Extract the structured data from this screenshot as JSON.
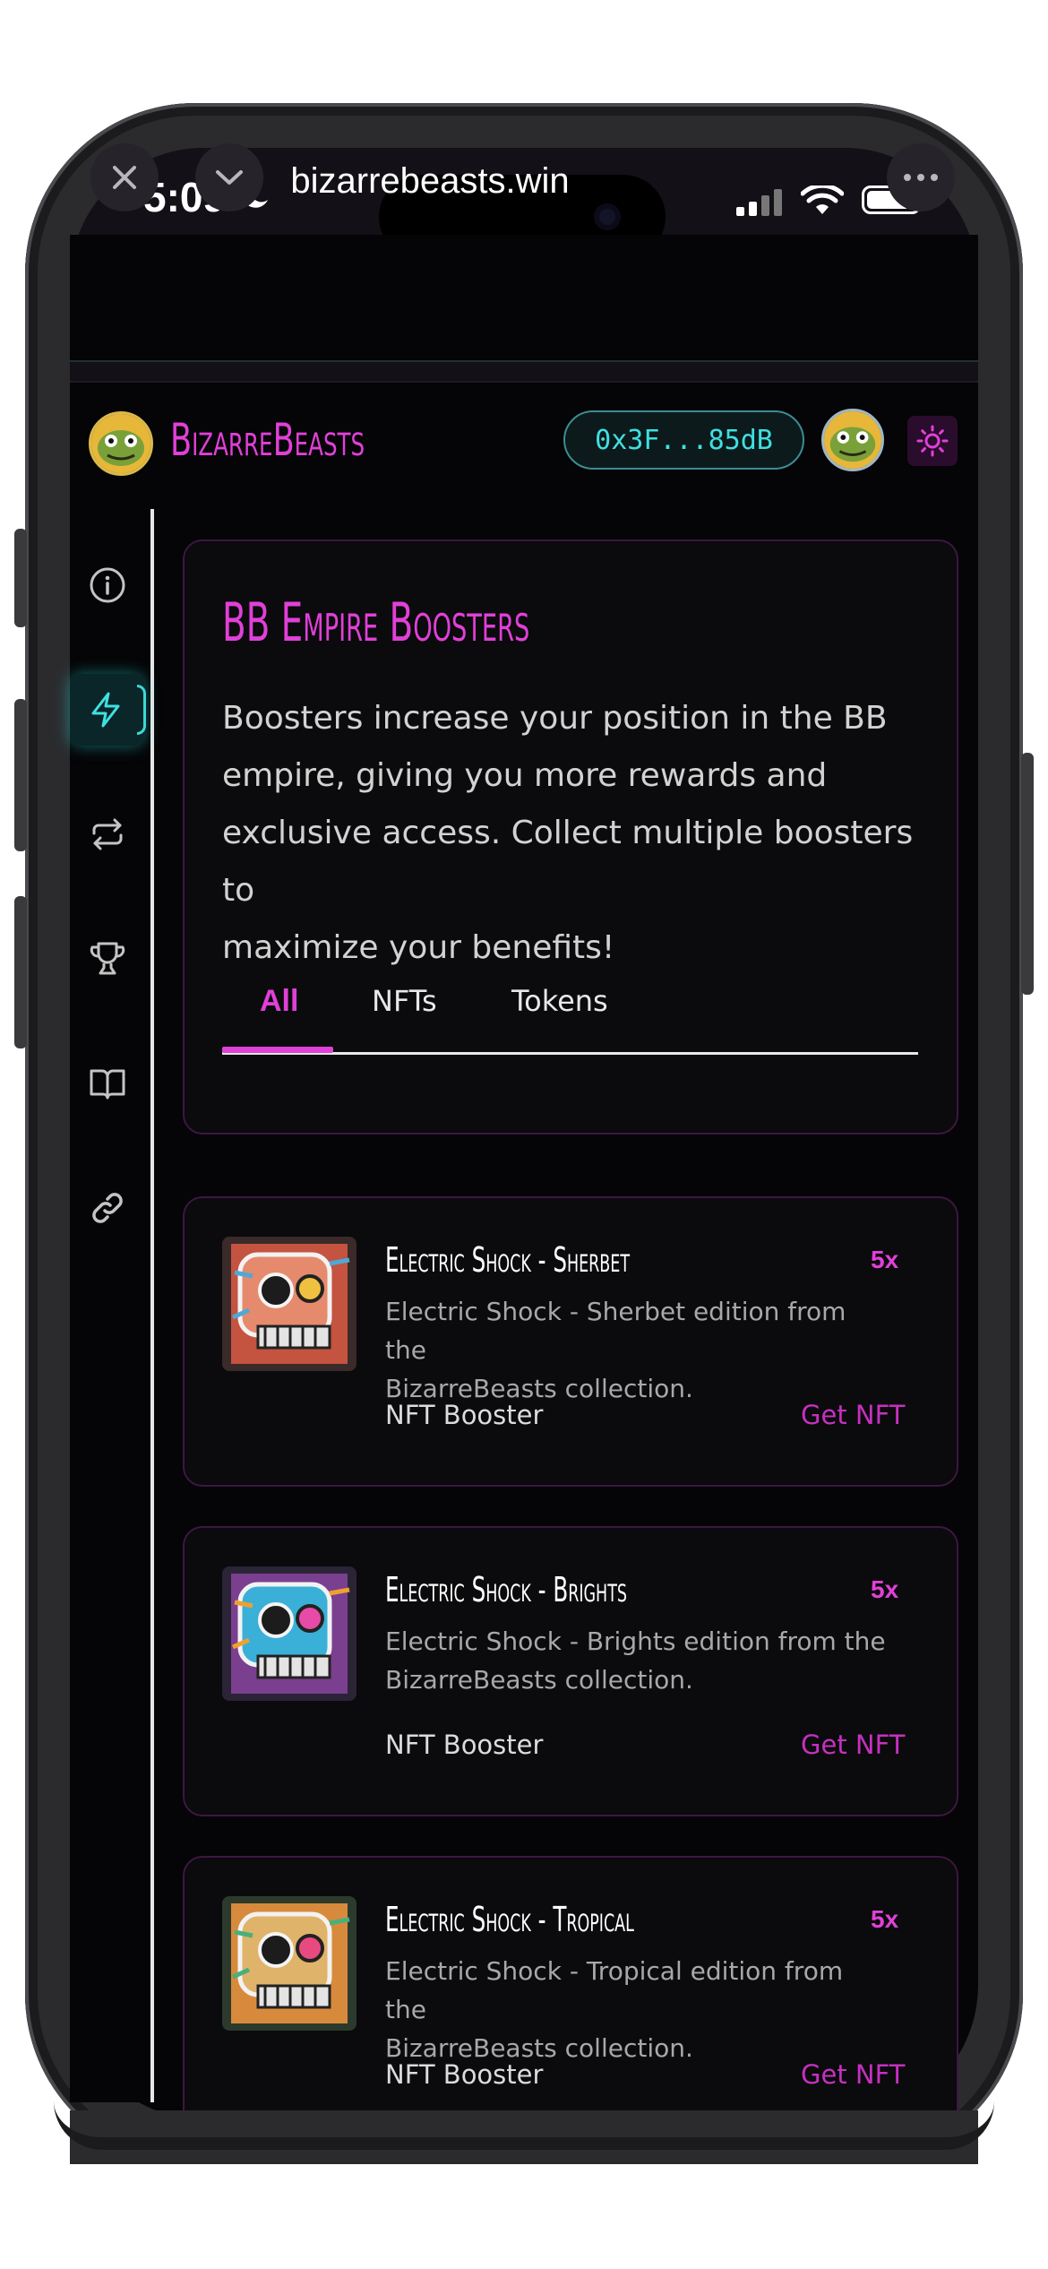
{
  "status": {
    "time": "5:09"
  },
  "browser": {
    "url": "bizarrebeasts.win"
  },
  "header": {
    "brand": "BizarreBeasts",
    "wallet": "0x3F...85dB"
  },
  "sidebar": {
    "items": [
      "info-icon",
      "lightning-icon",
      "swap-icon",
      "trophy-icon",
      "book-icon",
      "link-icon"
    ],
    "active": "lightning-icon"
  },
  "intro": {
    "title": "BB Empire Boosters",
    "lines": [
      "Boosters increase your position in the BB",
      "empire, giving you more rewards and",
      "exclusive access. Collect multiple boosters to",
      "maximize your benefits!"
    ],
    "tabs": [
      "All",
      "NFTs",
      "Tokens"
    ]
  },
  "boosters": [
    {
      "title": "Electric Shock - Sherbet",
      "multiplier": "5x",
      "desc_line1": "Electric Shock - Sherbet edition from the",
      "desc_line2": "BizarreBeasts collection.",
      "type": "NFT Booster",
      "action": "Get NFT"
    },
    {
      "title": "Electric Shock - Brights",
      "multiplier": "5x",
      "desc_line1": "Electric Shock - Brights edition from the",
      "desc_line2": "BizarreBeasts collection.",
      "type": "NFT Booster",
      "action": "Get NFT"
    },
    {
      "title": "Electric Shock - Tropical",
      "multiplier": "5x",
      "desc_line1": "Electric Shock - Tropical edition from the",
      "desc_line2": "BizarreBeasts collection.",
      "type": "NFT Booster",
      "action": "Get NFT"
    }
  ],
  "colors": {
    "accent": "#e040d8",
    "cyan": "#3fe0e0",
    "background": "#050406"
  }
}
